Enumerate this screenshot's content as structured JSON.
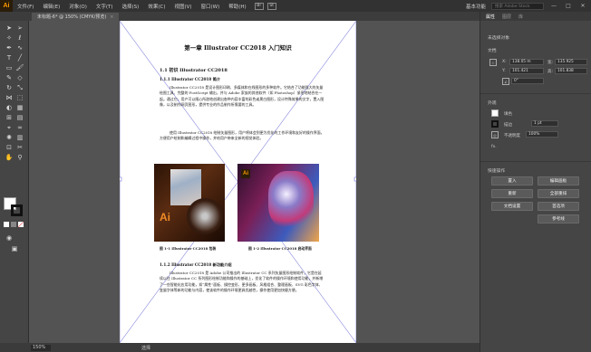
{
  "app": {
    "logo": "Ai"
  },
  "menu": [
    "文件(F)",
    "编辑(E)",
    "对象(O)",
    "文字(T)",
    "选择(S)",
    "效果(C)",
    "视图(V)",
    "窗口(W)",
    "帮助(H)"
  ],
  "menubar_right": {
    "workspace": "基本功能",
    "search_placeholder": "搜索 Adobe Stock",
    "minimize": "—",
    "maximize": "□",
    "close": "✕"
  },
  "menubar_icons": [
    "Br",
    "St"
  ],
  "document_tab": {
    "label": "未标题-6* @ 150% (CMYK/预览)",
    "close": "×"
  },
  "document": {
    "title": "第一章  Illustrator CC2018 入门知识",
    "section1": "1.1 初识 Illustrator CC2018",
    "sub1": "1.1.1 Illustrator CC2018 简介",
    "para1": "Illustrator CC2018 是设计图形印刷、多媒体和在线图形的多种软件。它结合了功能强大的矢量绘图工具、完整的 PostScript 输出，并与 Adobe 家族的其他软件（如 Photoshop）紧密地结合在一起。通过它，用户可以随心所欲地创建出各种内容丰富的彩色或黑白图形，设计特殊效果的文字，置入图像，以及制作网页图形，提供专业的作品制作所需要的工具。",
    "para2": "使用 Illustrator CC2018 绘制矢量图形，用户将体会到更为优化的工作环境和友好的操作界面，方便用户绘制和编辑过程中操作，并给用户带来全新的视觉体验。",
    "caption1": "图 1-1  Illustrator CC2018 包装",
    "caption2": "图 1-2  Illustrator CC2018 启动界面",
    "fig1_logo": "Ai",
    "fig2_logo": "Ai",
    "sub2": "1.1.2 Illustrator CC2018 新功能介绍",
    "para3": "Illustrator CC2018 是 Adobe 公司推出的 Illustrator CC 系列矢量图形绘制软件，它是在延续以往 Illustrator CC 系列图形绘制功能和操作的基础上，优化了软件的操作环境和使用功能，并新增了一些智能化应用功能，如“属性”面板、操控变形、更多画板、风格组合、整理画板、SVG 彩色字体、变量字体等新的功能与内容，使该软件的操作环境更具优越性，操作使用更加快捷方便。"
  },
  "status": {
    "zoom": "150%",
    "mode": "选择"
  },
  "panel": {
    "tabs": [
      "属性",
      "图层",
      "库"
    ],
    "no_selection": "未选择对象",
    "doc_section": "文档",
    "x_label": "X:",
    "x_value": "138.05 m",
    "y_label": "Y:",
    "y_value": "101.421",
    "w_label": "宽:",
    "w_value": "135.925",
    "h_label": "高:",
    "h_value": "101.838",
    "angle_value": "0°",
    "appearance": "外观",
    "fill_label": "填色",
    "stroke_label": "描边",
    "stroke_weight": "1 pt",
    "opacity_label": "不透明度",
    "opacity_value": "100%",
    "fx": "fx.",
    "quick_actions": "快速操作",
    "btn_import": "置入",
    "btn_edit_artboard": "编辑画板",
    "btn_reset": "重新",
    "btn_rearrange": "全部重排",
    "btn_document_setup": "文档设置",
    "btn_preferences": "首选项",
    "btn_guides": "参考线"
  },
  "colors": {
    "accent": "#ff9a00",
    "ui_dark": "#323232",
    "ui_mid": "#535353",
    "guide": "#8a8adf"
  }
}
